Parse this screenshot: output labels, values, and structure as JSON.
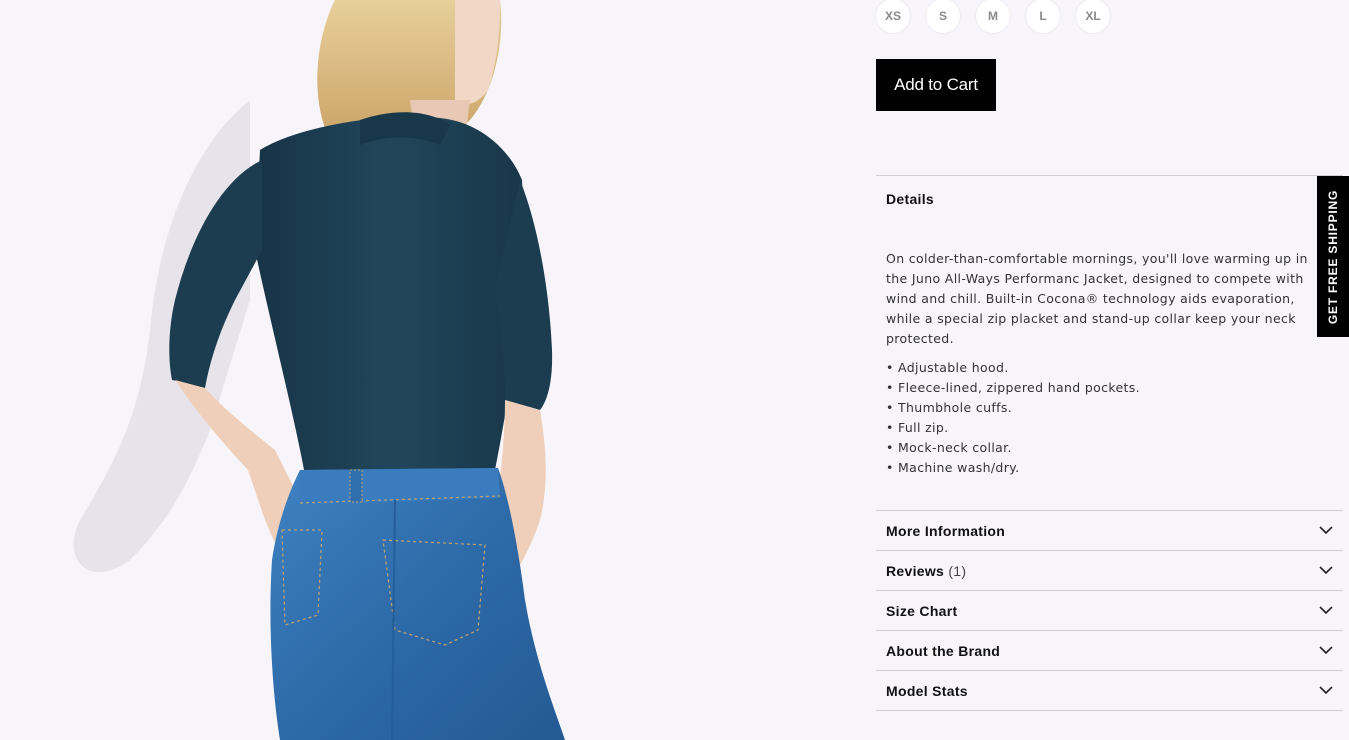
{
  "product": {
    "image_alt": "Model wearing dark teal button-up shirt and blue jeans, back view",
    "sizes": [
      "XS",
      "S",
      "M",
      "L",
      "XL"
    ],
    "add_to_cart_label": "Add to Cart"
  },
  "details": {
    "title": "Details",
    "description": [
      "On colder-than-comfortable mornings, you'll love warming up in",
      "the Juno All-Ways Performanc Jacket, designed to compete with",
      "wind and chill. Built-in Cocona® technology aids evaporation,",
      "while a special zip placket and stand-up collar keep your neck",
      "protected."
    ],
    "bullets": [
      "• Adjustable hood.",
      "• Fleece-lined, zippered hand pockets.",
      "• Thumbhole cuffs.",
      "• Full zip.",
      "• Mock-neck collar.",
      "• Machine wash/dry."
    ]
  },
  "accordion": {
    "more_info": "More Information",
    "reviews": "Reviews",
    "reviews_count": "(1)",
    "size_chart": "Size Chart",
    "about_brand": "About the Brand",
    "model_stats": "Model Stats"
  },
  "promo": {
    "free_shipping_label": "GET FREE SHIPPING"
  },
  "colors": {
    "button_bg": "#000000",
    "shirt": "#1f4255",
    "jeans": "#2e6fae",
    "background": "#f7f5fa"
  }
}
